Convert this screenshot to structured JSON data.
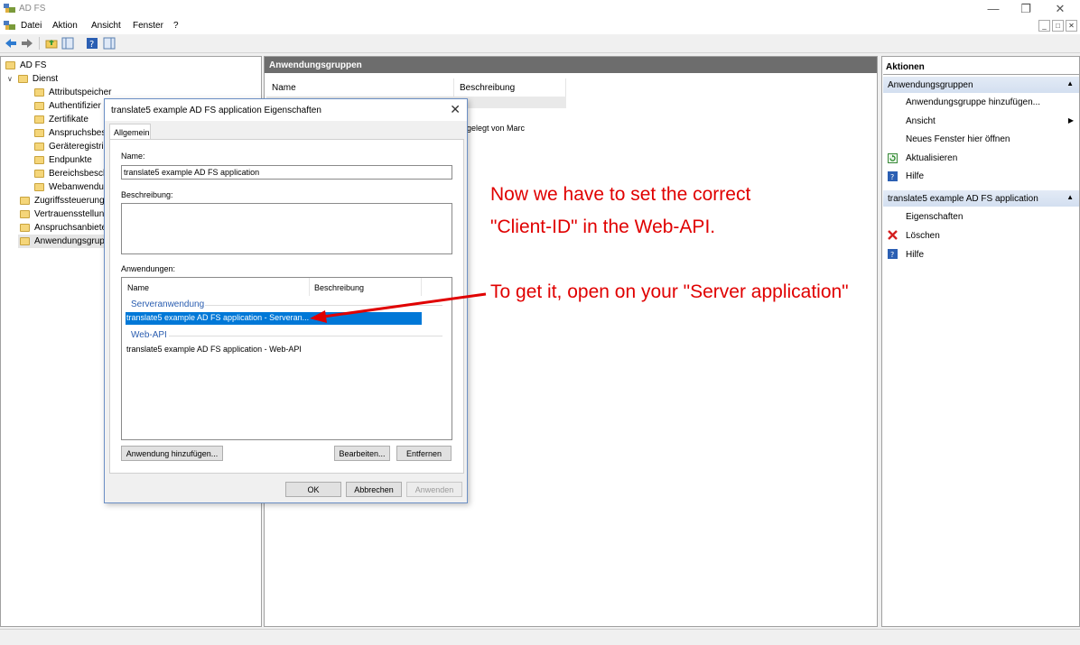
{
  "window": {
    "title": "AD FS"
  },
  "menu": {
    "items": [
      "Datei",
      "Aktion",
      "Ansicht",
      "Fenster",
      "?"
    ]
  },
  "tree": {
    "root": "AD FS",
    "dienst": "Dienst",
    "children": [
      "Attributspeicher",
      "Authentifizier",
      "Zertifikate",
      "Anspruchsbesc",
      "Geräteregistrie",
      "Endpunkte",
      "Bereichsbesch",
      "Webanwendu"
    ],
    "top_items": [
      "Zugriffssteuerung",
      "Vertrauensstellung",
      "Anspruchsanbiete",
      "Anwendungsgrup"
    ]
  },
  "center": {
    "header": "Anwendungsgruppen",
    "col_name": "Name",
    "col_desc": "Beschreibung",
    "row_desc": "gelegt von Marc"
  },
  "actions": {
    "header": "Aktionen",
    "section1": "Anwendungsgruppen",
    "section1_items": [
      "Anwendungsgruppe hinzufügen...",
      "Ansicht",
      "Neues Fenster hier öffnen",
      "Aktualisieren",
      "Hilfe"
    ],
    "section2": "translate5 example AD FS application",
    "section2_items": [
      "Eigenschaften",
      "Löschen",
      "Hilfe"
    ]
  },
  "dialog": {
    "title": "translate5 example AD FS application Eigenschaften",
    "tab": "Allgemein",
    "name_label": "Name:",
    "name_value": "translate5 example AD FS application",
    "desc_label": "Beschreibung:",
    "desc_value": "",
    "apps_label": "Anwendungen:",
    "col_name": "Name",
    "col_desc": "Beschreibung",
    "group1": "Serveranwendung",
    "group1_item": "translate5 example AD FS application - Serveran...",
    "group2": "Web-API",
    "group2_item": "translate5 example AD FS application - Web-API",
    "btn_add": "Anwendung hinzufügen...",
    "btn_edit": "Bearbeiten...",
    "btn_remove": "Entfernen",
    "btn_ok": "OK",
    "btn_cancel": "Abbrechen",
    "btn_apply": "Anwenden"
  },
  "annotation": {
    "line1": "Now we have to set the correct",
    "line2": "\"Client-ID\" in the Web-API.",
    "line3": "To get it, open on your \"Server application\"",
    "color": "#e00000"
  }
}
